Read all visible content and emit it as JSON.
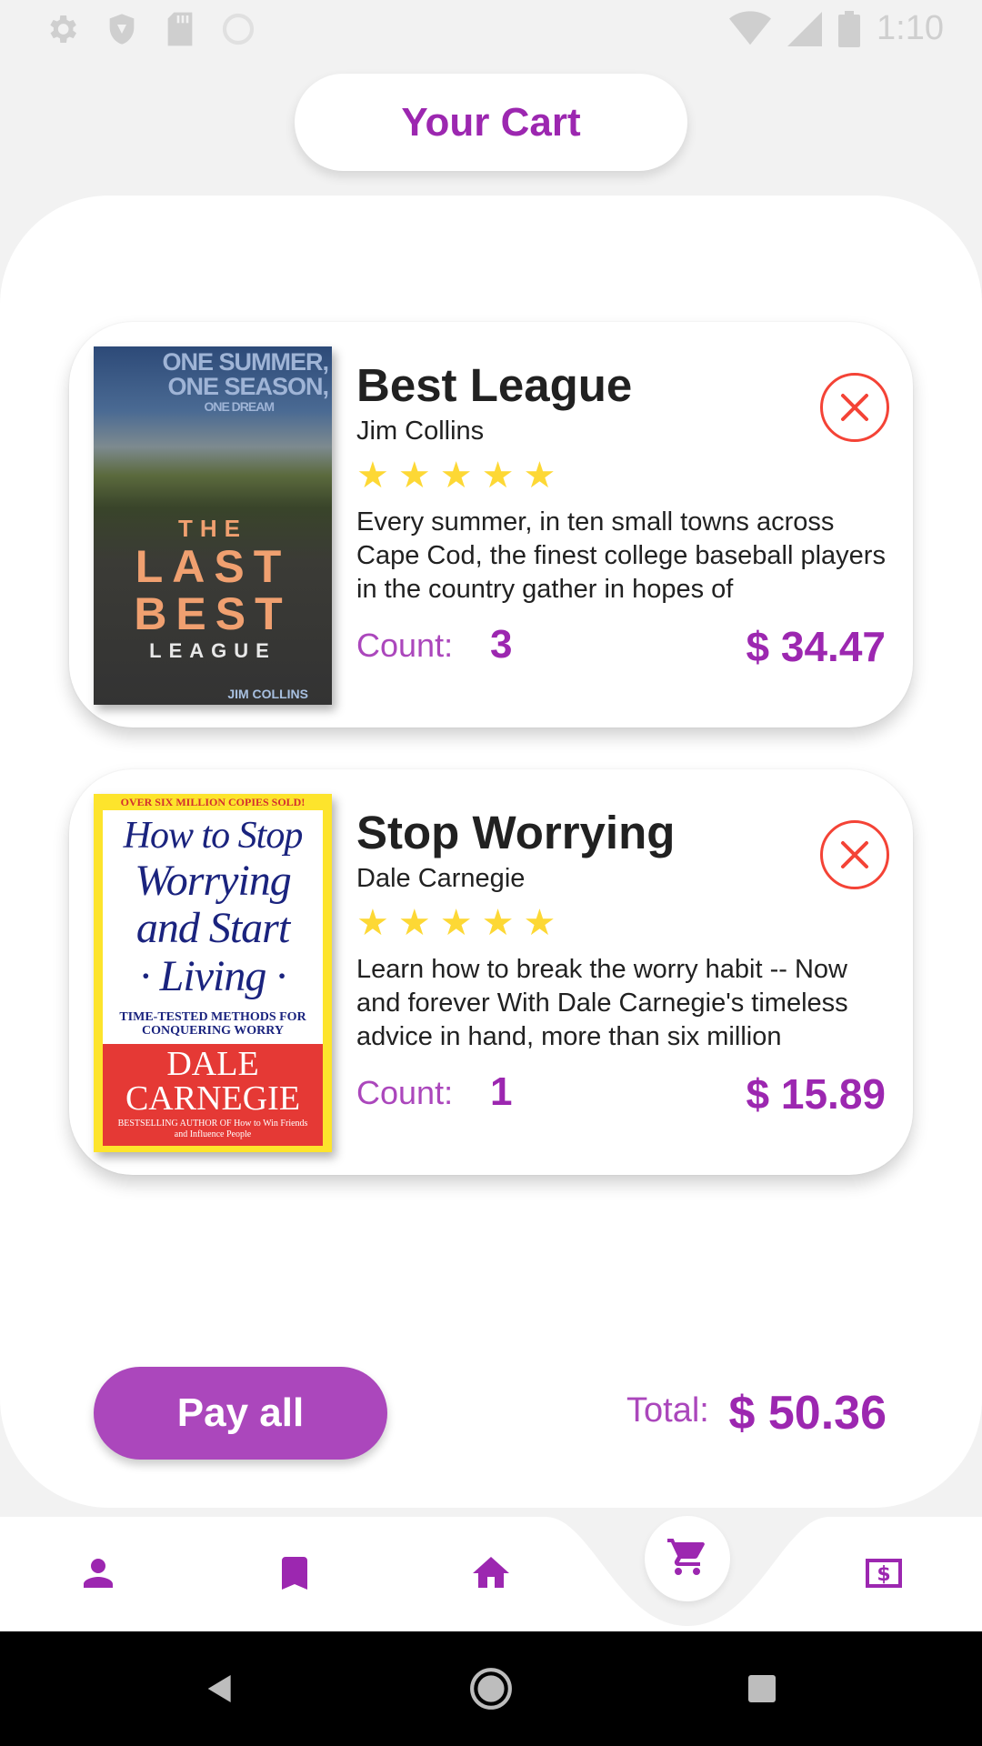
{
  "status_bar": {
    "time": "1:10",
    "left_icons": [
      "settings-icon",
      "shield-icon",
      "sd-card-icon",
      "sync-icon"
    ],
    "right_icons": [
      "wifi-icon",
      "signal-icon",
      "battery-icon"
    ]
  },
  "header": {
    "title": "Your Cart"
  },
  "cart": {
    "items": [
      {
        "title": "Best League",
        "author": "Jim Collins",
        "rating": 5,
        "stars": "★★★★★",
        "description": "Every summer, in ten small towns across Cape Cod, the finest college baseball players in the country gather in hopes of",
        "count_label": "Count:",
        "count": "3",
        "price": "$ 34.47",
        "cover": {
          "top_text_1": "ONE SUMMER,",
          "top_text_2": "ONE SEASON,",
          "top_text_3": "ONE DREAM",
          "line_1": "THE",
          "line_2": "LAST",
          "line_3": "BEST",
          "line_4": "LEAGUE",
          "author": "JIM COLLINS"
        }
      },
      {
        "title": "Stop Worrying",
        "author": "Dale Carnegie",
        "rating": 5,
        "stars": "★★★★★",
        "description": "Learn how to break the worry habit -- Now and forever With Dale Carnegie's timeless advice in hand, more than six million",
        "count_label": "Count:",
        "count": "1",
        "price": "$ 15.89",
        "cover": {
          "banner": "OVER SIX MILLION COPIES SOLD!",
          "line_1": "How to Stop",
          "line_2": "Worrying",
          "line_3": "and Start",
          "line_4": "· Living ·",
          "subtitle": "TIME-TESTED METHODS FOR CONQUERING WORRY",
          "author_1": "DALE",
          "author_2": "CARNEGIE",
          "footer": "BESTSELLING AUTHOR OF How to Win Friends and Influence People"
        }
      }
    ]
  },
  "footer": {
    "pay_label": "Pay all",
    "total_label": "Total:",
    "total_value": "$ 50.36"
  },
  "nav": {
    "items": [
      "person-icon",
      "bookmark-icon",
      "home-icon",
      "cart-icon",
      "wallet-icon"
    ],
    "active": "cart-icon"
  },
  "colors": {
    "accent": "#9c27b0",
    "accent_light": "#ab47bc",
    "remove": "#f44336",
    "star": "#fdd835"
  }
}
